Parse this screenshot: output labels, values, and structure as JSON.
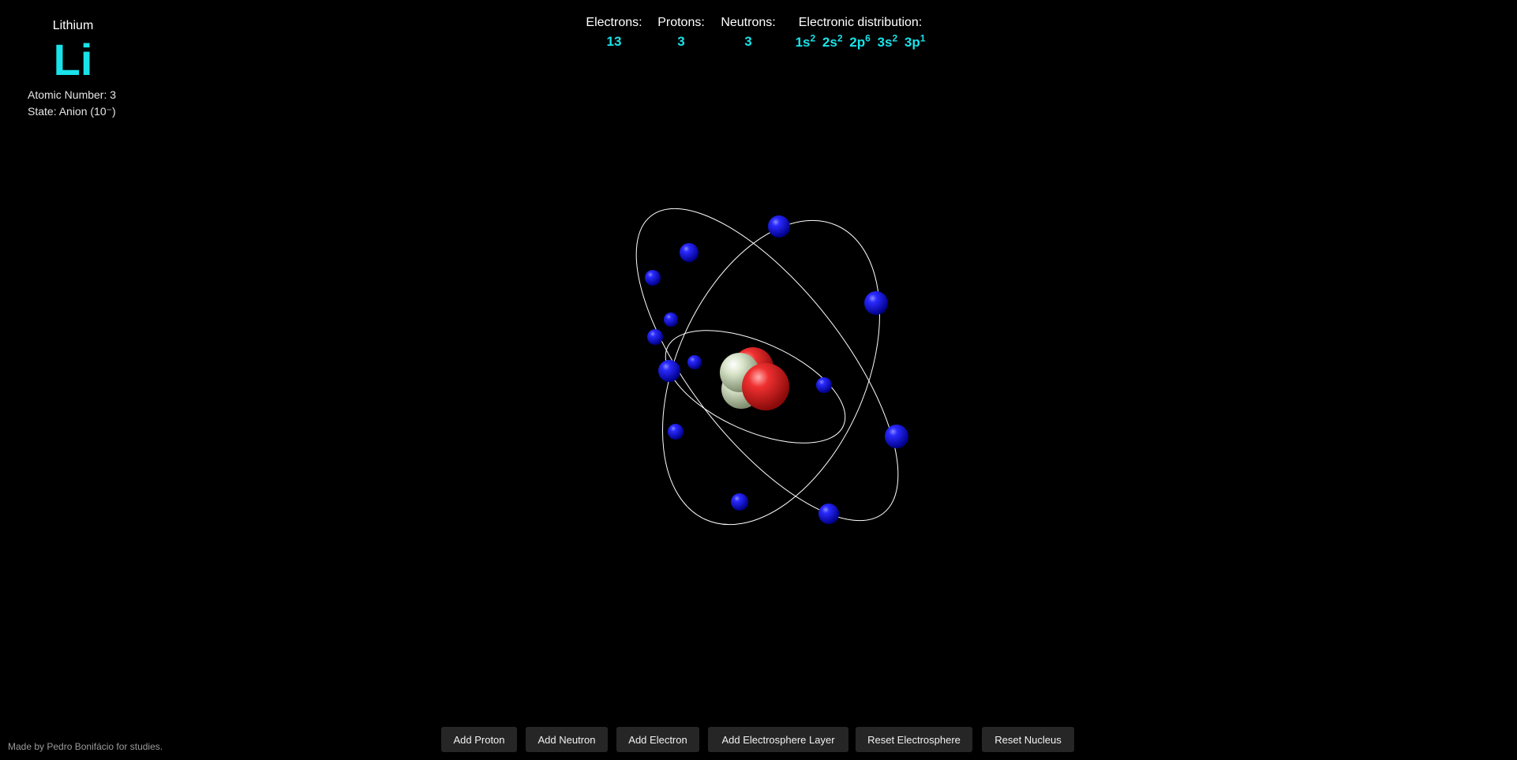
{
  "element": {
    "name": "Lithium",
    "symbol": "Li",
    "atomic_number_text": "Atomic Number: 3",
    "state_text": "State: Anion (10⁻)"
  },
  "stats": {
    "electrons_label": "Electrons:",
    "electrons_value": "13",
    "protons_label": "Protons:",
    "protons_value": "3",
    "neutrons_label": "Neutrons:",
    "neutrons_value": "3",
    "distribution_label": "Electronic distribution:",
    "distribution": [
      {
        "orbital": "1s",
        "count": "2"
      },
      {
        "orbital": "2s",
        "count": "2"
      },
      {
        "orbital": "2p",
        "count": "6"
      },
      {
        "orbital": "3s",
        "count": "2"
      },
      {
        "orbital": "3p",
        "count": "1"
      }
    ]
  },
  "buttons": {
    "add_proton": "Add Proton",
    "add_neutron": "Add Neutron",
    "add_electron": "Add Electron",
    "add_layer": "Add Electrosphere Layer",
    "reset_electrosphere": "Reset Electrosphere",
    "reset_nucleus": "Reset Nucleus"
  },
  "footer": {
    "credit": "Made by Pedro Bonifácio for studies."
  },
  "colors": {
    "accent": "#19e3ea",
    "electron": "#1010e0",
    "proton": "#e02020",
    "neutron": "#c8d8b0",
    "orbit": "#ffffff"
  },
  "icons": [
    "atom-nucleus",
    "electron-sphere"
  ]
}
